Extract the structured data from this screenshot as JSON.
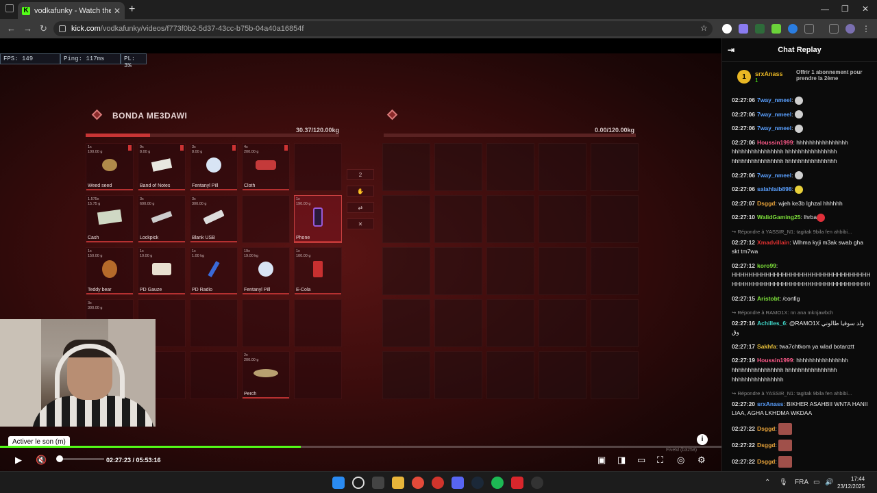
{
  "browser": {
    "tab_title": "vodkafunky - Watch the VOD o",
    "tab_favicon": "K",
    "url_host": "kick.com",
    "url_path": "/vodkafunky/videos/f773f0b2-5d37-43cc-b75b-04a40a16854f"
  },
  "perf": {
    "fps": "FPS: 149",
    "ping": "Ping: 117ms",
    "pl": "PL: 3%"
  },
  "inventory": {
    "title": "BONDA ME3DAWI",
    "weight_left": "30.37/120.00kg",
    "weight_right": "0.00/120.00kg",
    "weight_left_fraction": 0.253,
    "slots": [
      {
        "qty": "1x",
        "w": "100.00 g",
        "name": "Weed seed",
        "icon": "weed-seed-icon"
      },
      {
        "qty": "9x",
        "w": "8.00 g",
        "name": "Band of Notes",
        "icon": "band-of-notes-icon"
      },
      {
        "qty": "3x",
        "w": "8.00 g",
        "name": "Fentanyl Pill",
        "icon": "fentanyl-pill-icon"
      },
      {
        "qty": "4x",
        "w": "200.00 g",
        "name": "Cloth",
        "icon": "cloth-icon"
      },
      {
        "qty": "1.575x",
        "w": "15.75 g",
        "name": "Cash",
        "icon": "cash-icon"
      },
      {
        "qty": "3x",
        "w": "600.00 g",
        "name": "Lockpick",
        "icon": "lockpick-icon"
      },
      {
        "qty": "3x",
        "w": "300.00 g",
        "name": "Blank USB",
        "icon": "blank-usb-icon"
      },
      {
        "qty": "1x",
        "w": "190.00 g",
        "name": "Phone",
        "icon": "phone-icon"
      },
      {
        "qty": "1x",
        "w": "150.00 g",
        "name": "Teddy bear",
        "icon": "teddy-bear-icon"
      },
      {
        "qty": "1x",
        "w": "10.00 g",
        "name": "PD Gauze",
        "icon": "gauze-icon"
      },
      {
        "qty": "1x",
        "w": "1.00 kg",
        "name": "PD Radio",
        "icon": "radio-icon"
      },
      {
        "qty": "19x",
        "w": "19.00 kg",
        "name": "Fentanyl Pill",
        "icon": "fentanyl-pill-icon"
      },
      {
        "qty": "1x",
        "w": "100.00 g",
        "name": "E-Cola",
        "icon": "ecola-icon"
      },
      {
        "qty": "3x",
        "w": "300.00 g",
        "name": "",
        "icon": ""
      },
      {
        "qty": "2x",
        "w": "200.00 g",
        "name": "Perch",
        "icon": "perch-icon"
      }
    ],
    "amount": "2"
  },
  "player": {
    "tooltip": "Activer le son (m)",
    "time": "02:27:23 / 05:53:16",
    "progress": 0.417,
    "watermark": "FiveM (b3258)"
  },
  "chat": {
    "header": "Chat Replay",
    "pinned_user": "srxAnass",
    "pinned_count": "1",
    "pinned_offer": "Offrir 1 abonnement pour prendre la 2ème",
    "messages": [
      {
        "t": "02:27:06",
        "u": "7way_nmeel",
        "c": "#5aa0ff",
        "txt": "",
        "emote": "face"
      },
      {
        "t": "02:27:06",
        "u": "7way_nmeel",
        "c": "#5aa0ff",
        "txt": "",
        "emote": "face"
      },
      {
        "t": "02:27:06",
        "u": "7way_nmeel",
        "c": "#5aa0ff",
        "txt": "",
        "emote": "face"
      },
      {
        "t": "02:27:06",
        "u": "Houssin1999",
        "c": "#ff5a8a",
        "txt": "hhhhhhhhhhhhhhhh hhhhhhhhhhhhhhhh hhhhhhhhhhhhhhhh hhhhhhhhhhhhhhhh hhhhhhhhhhhhhhhh",
        "emote": ""
      },
      {
        "t": "02:27:06",
        "u": "7way_nmeel",
        "c": "#5aa0ff",
        "txt": "",
        "emote": "face"
      },
      {
        "t": "02:27:06",
        "u": "salahlaib898",
        "c": "#5aa0ff",
        "txt": "",
        "emote": "yellow"
      },
      {
        "t": "02:27:07",
        "u": "Dsggd",
        "c": "#e8a33a",
        "txt": "wjeh ke3b lghzal hhhhhh",
        "emote": ""
      },
      {
        "t": "02:27:10",
        "u": "WalidGaming25",
        "c": "#7ee23a",
        "txt": "lhrba",
        "emote": "red"
      },
      {
        "reply": "Répondre à YASSIR_N1: tagitak 9bila fen ahbibi...",
        "t": "02:27:12",
        "u": "Xmadvillain",
        "c": "#e03030",
        "txt": "Wlhma kyji m3ak swab gha skt tm7wa",
        "emote": ""
      },
      {
        "t": "02:27:12",
        "u": "koro99",
        "c": "#7ee23a",
        "txt": "HHHHHHHHHHHHHHHHHHHHHHHHHHHHHHHHHHHHHHHHHHHHHHHHHHHHHHHHHHHHHHHHHH",
        "emote": ""
      },
      {
        "t": "02:27:15",
        "u": "Aristobt",
        "c": "#7ee23a",
        "txt": "/config",
        "emote": ""
      },
      {
        "reply": "Répondre à RAMO1X: nn ana mknjawbch",
        "t": "02:27:16",
        "u": "Achilles_6",
        "c": "#3fd6c8",
        "txt": "@RAMO1X ولد سوفيا طالوني وق",
        "emote": ""
      },
      {
        "t": "02:27:17",
        "u": "Sakhfa",
        "c": "#e8c03a",
        "txt": "twa7chtkom ya wlad botanztt",
        "emote": ""
      },
      {
        "t": "02:27:19",
        "u": "Houssin1999",
        "c": "#ff5a8a",
        "txt": "hhhhhhhhhhhhhhhh hhhhhhhhhhhhhhhh hhhhhhhhhhhhhhhh hhhhhhhhhhhhhhhh",
        "emote": ""
      },
      {
        "reply": "Répondre à YASSIR_N1: tagitak 9bila fen ahbibi...",
        "t": "02:27:20",
        "u": "srxAnass",
        "c": "#5aa0ff",
        "txt": "BIKHER ASAHBII WNTA HANII LIAA, AGHA LKHDMA WKDAA",
        "emote": ""
      },
      {
        "t": "02:27:22",
        "u": "Dsggd",
        "c": "#e8a33a",
        "txt": "",
        "emote": "big"
      },
      {
        "t": "02:27:22",
        "u": "Dsggd",
        "c": "#e8a33a",
        "txt": "",
        "emote": "big"
      },
      {
        "t": "02:27:22",
        "u": "Dsggd",
        "c": "#e8a33a",
        "txt": "",
        "emote": "big"
      },
      {
        "t": "02:27:22",
        "u": "Dsggd",
        "c": "#e8a33a",
        "txt": "",
        "emote": "big"
      }
    ]
  },
  "taskbar": {
    "lang": "FRA",
    "time": "17:44",
    "date": "23/12/2025"
  }
}
